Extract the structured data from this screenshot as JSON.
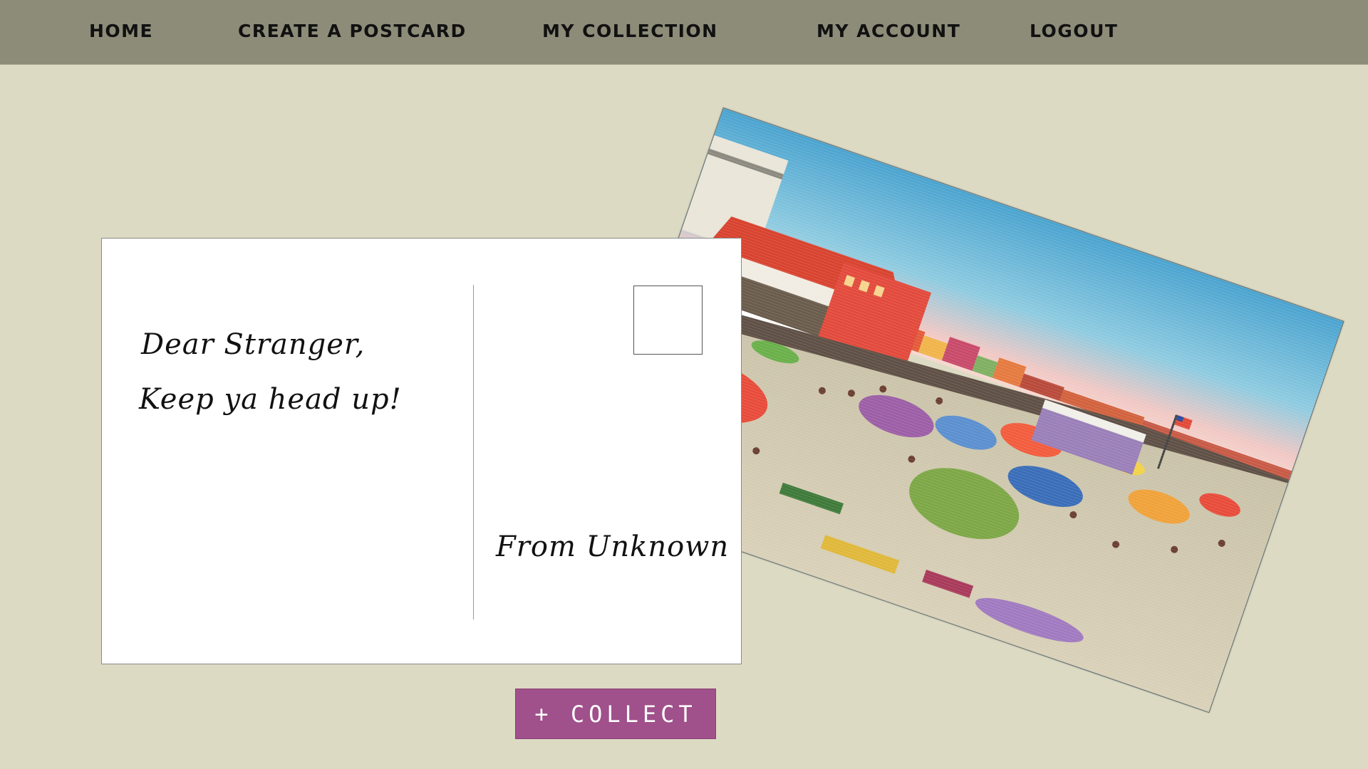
{
  "nav": {
    "home": "Home",
    "create": "Create a Postcard",
    "collection": "My Collection",
    "account": "My Account",
    "logout": "Logout"
  },
  "postcard": {
    "greeting": "Dear Stranger,",
    "message": "Keep ya head up!",
    "signature": "From Unknown",
    "image": "vintage-beach-boardwalk-illustration"
  },
  "actions": {
    "collect_label": "+ COLLECT"
  },
  "colors": {
    "background": "#dcdac3",
    "navbar": "#8d8c79",
    "collect_button": "#a0508a"
  }
}
